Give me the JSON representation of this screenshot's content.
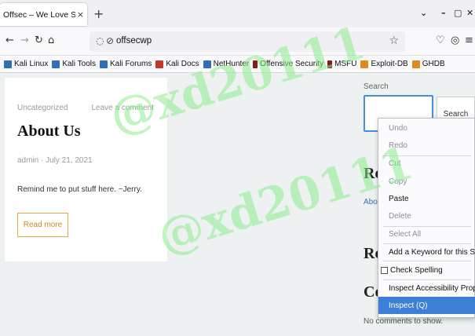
{
  "browser": {
    "tab_title": "Offsec – We Love Security To",
    "tab_close": "×",
    "new_tab": "+",
    "window_controls": [
      "⌄",
      "–",
      "▢",
      "✕"
    ],
    "url": "offsecwp",
    "bookmarks": [
      {
        "label": "Kali Linux",
        "color": "#2f6fb5"
      },
      {
        "label": "Kali Tools",
        "color": "#2f6fb5"
      },
      {
        "label": "Kali Forums",
        "color": "#2f6fb5"
      },
      {
        "label": "Kali Docs",
        "color": "#c0392b"
      },
      {
        "label": "NetHunter",
        "color": "#2f6fb5"
      },
      {
        "label": "Offensive Security",
        "color": "#8b1a1a"
      },
      {
        "label": "MSFU",
        "color": "#8b1a1a"
      },
      {
        "label": "Exploit-DB",
        "color": "#e08a1e"
      },
      {
        "label": "GHDB",
        "color": "#e08a1e"
      }
    ]
  },
  "post": {
    "category": "Uncategorized",
    "comment_link": "Leave a comment",
    "title": "About Us",
    "meta": "admin · July 21, 2021",
    "body": "Remind me to put stuff here. ~Jerry.",
    "read_more": "Read more"
  },
  "sidebar": {
    "search_label": "Search",
    "search_button": "Search",
    "heading_1": "Re",
    "link_1": "Abou",
    "heading_2": "Re",
    "heading_3": "Co",
    "no_comments": "No comments to show."
  },
  "context_menu": {
    "undo": "Undo",
    "redo": "Redo",
    "cut": "Cut",
    "copy": "Copy",
    "paste": "Paste",
    "delete": "Delete",
    "select_all": "Select All",
    "add_keyword": "Add a Keyword for this Search...",
    "check_spelling": "Check Spelling",
    "inspect_accessibility": "Inspect Accessibility Properties",
    "inspect": "Inspect (Q)"
  },
  "watermark": "@xd20111"
}
